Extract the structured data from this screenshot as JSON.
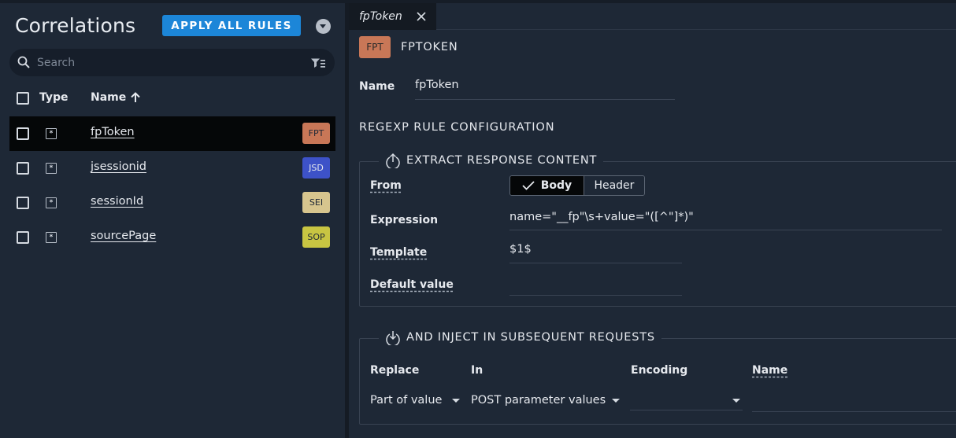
{
  "left_panel": {
    "title": "Correlations",
    "apply_button": "APPLY ALL RULES",
    "search": {
      "placeholder": "Search",
      "value": ""
    },
    "columns": {
      "type": "Type",
      "name": "Name"
    },
    "rows": [
      {
        "name": "fpToken",
        "badge": "FPT",
        "badge_color": "#c87757",
        "selected": true
      },
      {
        "name": "jsessionid",
        "badge": "JSD",
        "badge_color": "#3d52c8",
        "selected": false
      },
      {
        "name": "sessionId",
        "badge": "SEI",
        "badge_color": "#d7c58e",
        "selected": false
      },
      {
        "name": "sourcePage",
        "badge": "SOP",
        "badge_color": "#c8c542",
        "selected": false
      }
    ]
  },
  "right_panel": {
    "tab": {
      "label": "fpToken"
    },
    "header": {
      "badge": "FPT",
      "title": "FPTOKEN"
    },
    "name_field": {
      "label": "Name",
      "value": "fpToken"
    },
    "section_title": "REGEXP RULE CONFIGURATION",
    "extract": {
      "legend": "EXTRACT RESPONSE CONTENT",
      "from_label": "From",
      "from_options": [
        "Body",
        "Header"
      ],
      "from_selected": "Body",
      "expression_label": "Expression",
      "expression_value": "name=\"__fp\"\\s+value=\"([^\"]*)\"",
      "template_label": "Template",
      "template_value": "$1$",
      "default_label": "Default value",
      "default_value": ""
    },
    "inject": {
      "legend": "AND INJECT IN SUBSEQUENT REQUESTS",
      "columns": {
        "replace": "Replace",
        "in": "In",
        "encoding": "Encoding",
        "name": "Name"
      },
      "replace_value": "Part of value",
      "in_value": "POST parameter values",
      "encoding_value": "",
      "name_value": ""
    }
  },
  "colors": {
    "accent": "#1c86d8",
    "background": "#1e2836",
    "selected_row": "#050708"
  }
}
